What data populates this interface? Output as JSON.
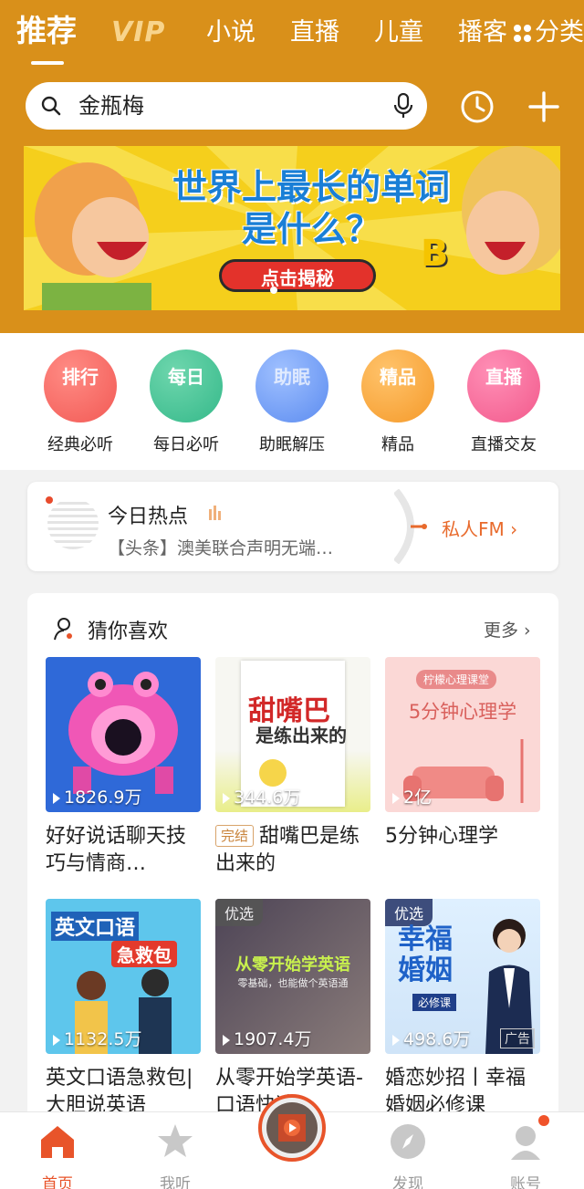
{
  "tabs": {
    "recommend": "推荐",
    "vip": "VIP",
    "novel": "小说",
    "live": "直播",
    "kids": "儿童",
    "podcast": "播客",
    "category": "分类"
  },
  "search": {
    "query": "金瓶梅"
  },
  "banner": {
    "title_line1": "世界上最长的单词",
    "title_line2": "是什么？",
    "button": "点击揭秘",
    "letter": "B"
  },
  "shortcuts": [
    {
      "icon_text": "排行",
      "label": "经典必听",
      "color": "#f25a55"
    },
    {
      "icon_text": "每日",
      "label": "每日必听",
      "color": "#35b98a"
    },
    {
      "icon_text": "助眠",
      "label": "助眠解压",
      "color": "#5c8cf0"
    },
    {
      "icon_text": "精品",
      "label": "精品",
      "color": "#f59a2a"
    },
    {
      "icon_text": "直播",
      "label": "直播交友",
      "color": "#f25a8c"
    }
  ],
  "hot": {
    "title": "今日热点",
    "subtitle": "【头条】澳美联合声明无端…",
    "fm": "私人FM ›"
  },
  "guess": {
    "title": "猜你喜欢",
    "more": "更多 ›",
    "items": [
      {
        "count": "1826.9万",
        "title": "好好说话聊天技巧与情商…"
      },
      {
        "count": "344.6万",
        "tag": "完结",
        "title": "甜嘴巴是练出来的",
        "cover_text1": "甜嘴巴",
        "cover_text2": "是练出来的"
      },
      {
        "count": "2亿",
        "title": "5分钟心理学",
        "cover_text": "5分钟心理学",
        "cover_tag": "柠檬心理课堂"
      },
      {
        "count": "1132.5万",
        "title": "英文口语急救包|大胆说英语",
        "cover_text1": "英文口语",
        "cover_text2": "急救包"
      },
      {
        "count": "1907.4万",
        "badge": "优选",
        "title": "从零开始学英语-口语快速…",
        "cover_text": "从零开始学英语",
        "cover_sub": "零基础，也能做个英语通"
      },
      {
        "count": "498.6万",
        "badge": "优选",
        "ad": "广告",
        "title": "婚恋妙招丨幸福婚姻必修课",
        "cover_text1": "幸福",
        "cover_text2": "婚姻",
        "cover_sub": "必修课"
      }
    ]
  },
  "nav": {
    "home": "首页",
    "listen": "我听",
    "discover": "发现",
    "account": "账号"
  }
}
